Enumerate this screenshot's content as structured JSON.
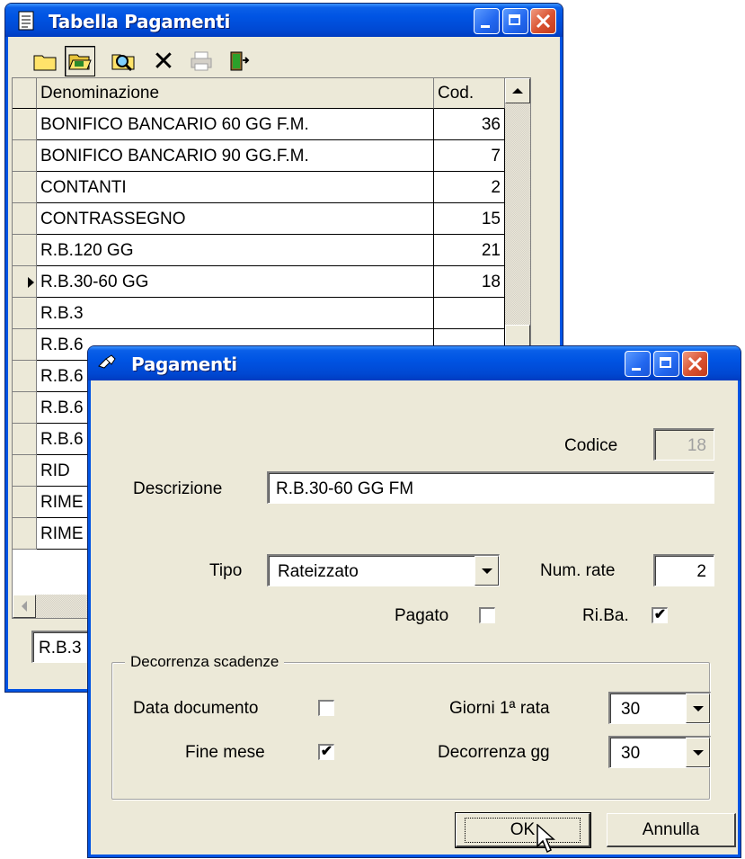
{
  "grid_window": {
    "title": "Tabella Pagamenti",
    "icon": "notepad-icon",
    "toolbar": [
      {
        "name": "new-folder-icon"
      },
      {
        "name": "open-folder-icon"
      },
      {
        "name": "search-icon"
      },
      {
        "name": "delete-icon",
        "glyph": "✕"
      },
      {
        "name": "print-icon"
      },
      {
        "name": "exit-door-icon"
      }
    ],
    "columns": {
      "name": "Denominazione",
      "code": "Cod."
    },
    "rows": [
      {
        "name": "BONIFICO BANCARIO 60 GG F.M.",
        "code": "36"
      },
      {
        "name": "BONIFICO BANCARIO 90 GG.F.M.",
        "code": "7"
      },
      {
        "name": "CONTANTI",
        "code": "2"
      },
      {
        "name": "CONTRASSEGNO",
        "code": "15"
      },
      {
        "name": "R.B.120 GG",
        "code": "21"
      },
      {
        "name": "R.B.30-60 GG",
        "code": "18",
        "current": true
      },
      {
        "name": "R.B.3",
        "code": ""
      },
      {
        "name": "R.B.6",
        "code": ""
      },
      {
        "name": "R.B.6",
        "code": ""
      },
      {
        "name": "R.B.6",
        "code": ""
      },
      {
        "name": "R.B.6",
        "code": ""
      },
      {
        "name": "RID",
        "code": ""
      },
      {
        "name": "RIME",
        "code": ""
      },
      {
        "name": "RIME",
        "code": ""
      }
    ],
    "search_value": "R.B.3"
  },
  "dialog": {
    "title": "Pagamenti",
    "icon": "pen-icon",
    "codice_label": "Codice",
    "codice_value": "18",
    "descrizione_label": "Descrizione",
    "descrizione_value": "R.B.30-60 GG FM",
    "tipo_label": "Tipo",
    "tipo_value": "Rateizzato",
    "num_rate_label": "Num. rate",
    "num_rate_value": "2",
    "pagato_label": "Pagato",
    "pagato_checked": false,
    "riba_label": "Ri.Ba.",
    "riba_checked": true,
    "group_title": "Decorrenza scadenze",
    "data_documento_label": "Data documento",
    "data_documento_checked": false,
    "fine_mese_label": "Fine mese",
    "fine_mese_checked": true,
    "giorni_prima_rata_label": "Giorni 1ª rata",
    "giorni_prima_rata_value": "30",
    "decorrenza_gg_label": "Decorrenza gg",
    "decorrenza_gg_value": "30",
    "ok_label": "OK",
    "annulla_label": "Annulla",
    "check_glyph": "✔"
  }
}
